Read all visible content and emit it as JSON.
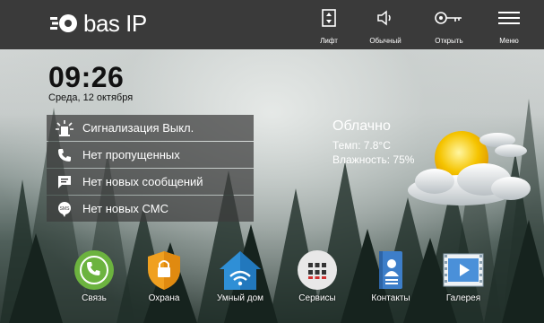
{
  "brand": {
    "name": "bas IP"
  },
  "toolbar": {
    "items": [
      {
        "label": "Лифт",
        "icon": "elevator-icon"
      },
      {
        "label": "Обычный",
        "icon": "speaker-icon"
      },
      {
        "label": "Открыть",
        "icon": "key-icon"
      },
      {
        "label": "Меню",
        "icon": "menu-icon"
      }
    ]
  },
  "clock": {
    "time": "09:26",
    "date": "Среда, 12 октября"
  },
  "status": {
    "items": [
      {
        "label": "Сигнализация Выкл.",
        "icon": "alarm-icon"
      },
      {
        "label": "Нет пропущенных",
        "icon": "phone-icon"
      },
      {
        "label": "Нет новых сообщений",
        "icon": "message-icon"
      },
      {
        "label": "Нет новых СМС",
        "icon": "sms-icon",
        "icon_text": "SMS"
      }
    ]
  },
  "weather": {
    "condition": "Облачно",
    "temperature": "Темп: 7.8°C",
    "humidity": "Влажность: 75%",
    "icon": "partly-cloudy-icon"
  },
  "dock": {
    "apps": [
      {
        "label": "Связь",
        "icon": "call-icon",
        "color": "#6cb33f"
      },
      {
        "label": "Охрана",
        "icon": "security-shield-icon",
        "color": "#f0a020"
      },
      {
        "label": "Умный дом",
        "icon": "smart-home-icon",
        "color": "#2f8fd6"
      },
      {
        "label": "Сервисы",
        "icon": "services-icon",
        "color": "#e8e8e8"
      },
      {
        "label": "Контакты",
        "icon": "contacts-icon",
        "color": "#3d7ec9"
      },
      {
        "label": "Галерея",
        "icon": "gallery-icon",
        "color": "#4a90d9"
      }
    ]
  }
}
